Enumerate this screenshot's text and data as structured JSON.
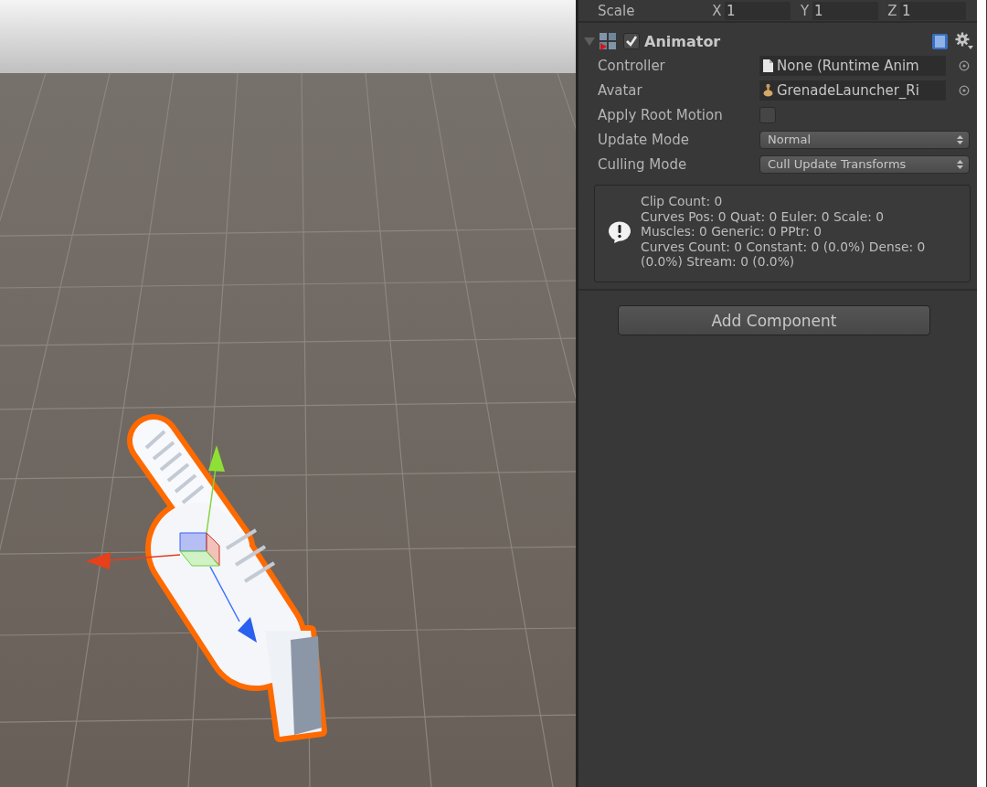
{
  "scale_row": {
    "label": "Scale",
    "axes": [
      {
        "axis": "X",
        "value": "1"
      },
      {
        "axis": "Y",
        "value": "1"
      },
      {
        "axis": "Z",
        "value": "1"
      }
    ]
  },
  "component": {
    "title": "Animator",
    "enabled": true,
    "expanded": true,
    "fields": [
      {
        "kind": "object",
        "label": "Controller",
        "value": "None (Runtime Anim"
      },
      {
        "kind": "object",
        "label": "Avatar",
        "value": "GrenadeLauncher_Ri"
      },
      {
        "kind": "checkbox",
        "label": "Apply Root Motion",
        "checked": false
      },
      {
        "kind": "dropdown",
        "label": "Update Mode",
        "value": "Normal"
      },
      {
        "kind": "dropdown",
        "label": "Culling Mode",
        "value": "Cull Update Transforms"
      }
    ],
    "info_lines": [
      "Clip Count: 0",
      "Curves Pos: 0 Quat: 0 Euler: 0 Scale: 0",
      "Muscles: 0 Generic: 0 PPtr: 0",
      "Curves Count: 0 Constant: 0 (0.0%) Dense: 0 (0.0%) Stream: 0 (0.0%)"
    ]
  },
  "add_component_button": "Add Component"
}
